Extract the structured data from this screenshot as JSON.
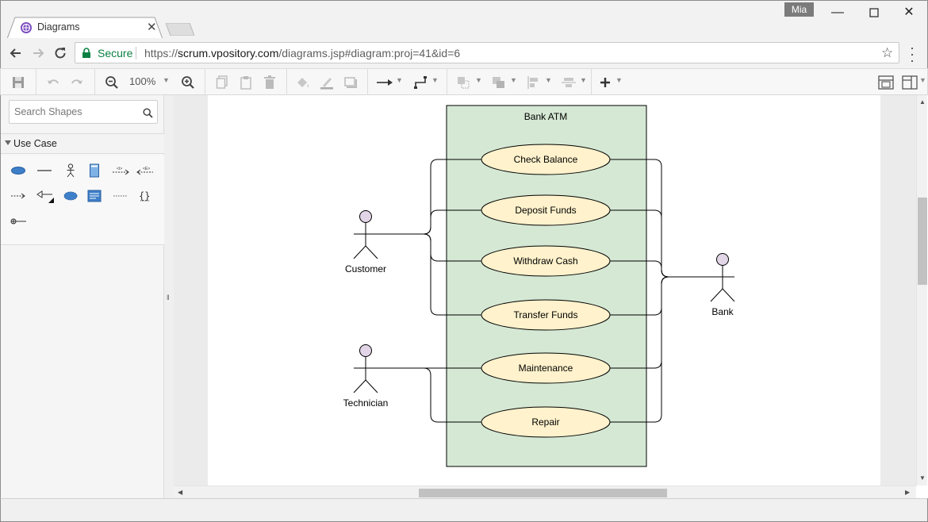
{
  "browser": {
    "tab_title": "Diagrams",
    "profile_label": "Mia",
    "secure_label": "Secure",
    "url_scheme": "https://",
    "url_host": "scrum.vpository.com",
    "url_path": "/diagrams.jsp#diagram:proj=41&id=6"
  },
  "toolbar": {
    "zoom_label": "100%"
  },
  "left_panel": {
    "search_placeholder": "Search Shapes",
    "section_label": "Use Case"
  },
  "diagram": {
    "system_title": "Bank ATM",
    "system_fill": "#d5e8d4",
    "usecase_fill": "#fff2cc",
    "actor_fill": "#e1d5e7",
    "actors": {
      "customer": "Customer",
      "technician": "Technician",
      "bank": "Bank"
    },
    "use_cases": {
      "check_balance": "Check Balance",
      "deposit_funds": "Deposit Funds",
      "withdraw_cash": "Withdraw Cash",
      "transfer_funds": "Transfer Funds",
      "maintenance": "Maintenance",
      "repair": "Repair"
    }
  }
}
